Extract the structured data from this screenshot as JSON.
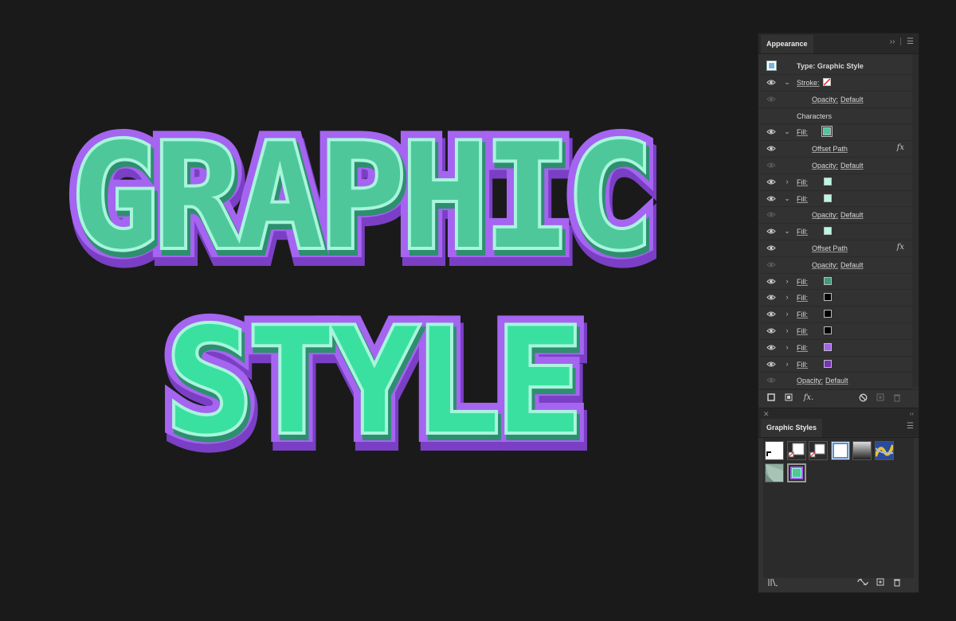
{
  "canvas": {
    "line1": "GRAPHIC",
    "line2": "STYLE",
    "colors": {
      "background": "#1a1a1a",
      "outer_stroke": "#a565f0",
      "outer_stroke_dark": "#7a3fc4",
      "line1_fill": "#4ec89a",
      "line2_fill": "#3ae0a0",
      "inner_outline": "#a8f5dc",
      "shadow": "#2e8f70"
    }
  },
  "appearance_panel": {
    "tab": "Appearance",
    "header_icons": [
      "expand-icon",
      "menu-icon"
    ],
    "type_label": "Type: Graphic Style",
    "rows": [
      {
        "kind": "stroke",
        "label": "Stroke:",
        "caret": "⌄",
        "swatch": "none",
        "eye": true
      },
      {
        "kind": "sub",
        "label": "Opacity:",
        "value": "Default",
        "eye": false
      },
      {
        "kind": "section",
        "label": "Characters"
      },
      {
        "kind": "fill",
        "label": "Fill:",
        "caret": "⌄",
        "swatch": "#4ec89a",
        "eye": true,
        "swatch_boxed": true
      },
      {
        "kind": "effect",
        "label": "Offset Path",
        "fx": "fx",
        "eye": true
      },
      {
        "kind": "sub",
        "label": "Opacity:",
        "value": "Default",
        "eye": false
      },
      {
        "kind": "fill",
        "label": "Fill:",
        "caret": "›",
        "swatch": "#b8f7e0",
        "eye": true
      },
      {
        "kind": "fill",
        "label": "Fill:",
        "caret": "⌄",
        "swatch": "#b8f7e0",
        "eye": true
      },
      {
        "kind": "sub",
        "label": "Opacity:",
        "value": "Default",
        "eye": false
      },
      {
        "kind": "fill",
        "label": "Fill:",
        "caret": "⌄",
        "swatch": "#b8f7e0",
        "eye": true
      },
      {
        "kind": "effect",
        "label": "Offset Path",
        "fx": "fx",
        "eye": true
      },
      {
        "kind": "sub",
        "label": "Opacity:",
        "value": "Default",
        "eye": false
      },
      {
        "kind": "fill",
        "label": "Fill:",
        "caret": "›",
        "swatch": "#3f9c78",
        "eye": true
      },
      {
        "kind": "fill",
        "label": "Fill:",
        "caret": "›",
        "swatch": "#000000",
        "eye": true
      },
      {
        "kind": "fill",
        "label": "Fill:",
        "caret": "›",
        "swatch": "#000000",
        "eye": true
      },
      {
        "kind": "fill",
        "label": "Fill:",
        "caret": "›",
        "swatch": "#000000",
        "eye": true
      },
      {
        "kind": "fill",
        "label": "Fill:",
        "caret": "›",
        "swatch": "#a066e6",
        "eye": true
      },
      {
        "kind": "fill",
        "label": "Fill:",
        "caret": "›",
        "swatch": "#7a33b8",
        "eye": true
      },
      {
        "kind": "main-opacity",
        "label": "Opacity:",
        "value": "Default",
        "eye": false
      }
    ],
    "bottom_icons": [
      "add-stroke-icon",
      "add-fill-icon",
      "fx-menu-icon",
      "clear-appearance-icon",
      "duplicate-item-icon",
      "delete-item-icon"
    ],
    "fx_bottom_label": "fx."
  },
  "graphic_styles_panel": {
    "tab": "Graphic Styles",
    "styles": [
      {
        "name": "default-graphic-style",
        "selected": false
      },
      {
        "name": "style-2",
        "selected": false
      },
      {
        "name": "style-3",
        "selected": false
      },
      {
        "name": "blue-outline-style",
        "selected": false
      },
      {
        "name": "gray-gradient-style",
        "selected": false
      },
      {
        "name": "blue-yellow-pattern-style",
        "selected": false
      },
      {
        "name": "green-texture-style",
        "selected": false
      },
      {
        "name": "graphic-style-current",
        "selected": true
      }
    ],
    "bottom_icons": [
      "libraries-menu-icon",
      "break-link-icon",
      "new-style-icon",
      "delete-style-icon"
    ]
  }
}
